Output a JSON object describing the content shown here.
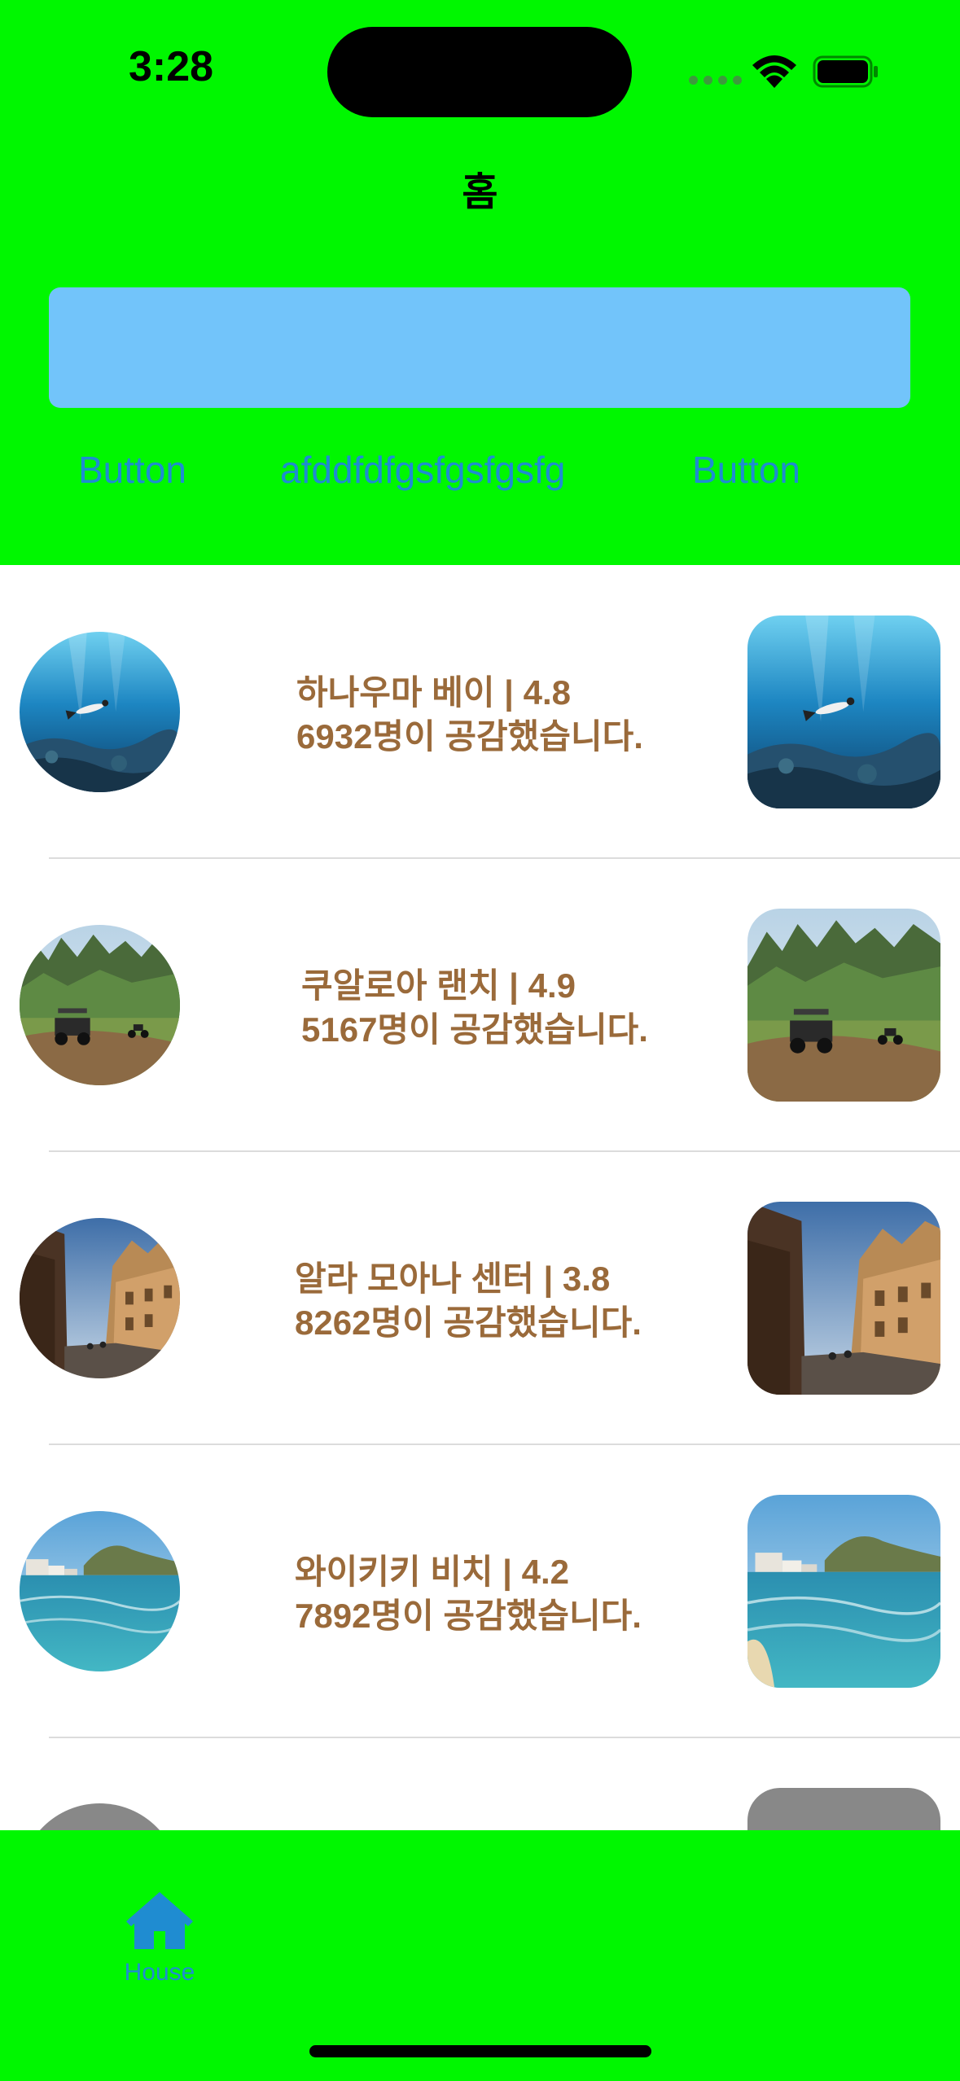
{
  "status_bar": {
    "time": "3:28"
  },
  "nav": {
    "title": "홈"
  },
  "top_buttons": {
    "left": "Button",
    "middle": "afddfdfgsfgsfgsfg",
    "right": "Button"
  },
  "list": [
    {
      "line1": "하나우마 베이 | 4.8",
      "line2": "6932명이 공감했습니다.",
      "image": "underwater-snorkeler"
    },
    {
      "line1": "쿠알로아 랜치 | 4.9",
      "line2": "5167명이 공감했습니다.",
      "image": "mountain-ranch-atv"
    },
    {
      "line1": "알라 모아나 센터 | 3.8",
      "line2": "8262명이 공감했습니다.",
      "image": "european-street"
    },
    {
      "line1": "와이키키 비치 | 4.2",
      "line2": "7892명이 공감했습니다.",
      "image": "waikiki-beach"
    }
  ],
  "tabbar": {
    "tab_label": "House",
    "icon": "house-icon"
  },
  "colors": {
    "header_green": "#00f700",
    "search_blue": "#72c4fa",
    "link_blue": "#1f8cd1",
    "row_text_brown": "#9a6a3a",
    "placeholder_gray": "#888888"
  }
}
